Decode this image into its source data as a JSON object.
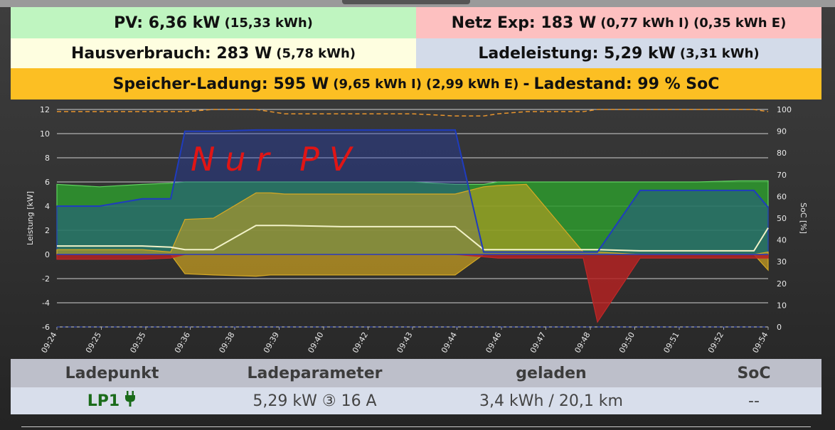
{
  "summary": {
    "pv_main": "PV: 6,36 kW",
    "pv_sub": "(15,33 kWh)",
    "netz_main": "Netz Exp: 183 W",
    "netz_sub1": "(0,77 kWh I)",
    "netz_sub2": "(0,35 kWh E)",
    "haus_main": "Hausverbrauch: 283 W",
    "haus_sub": "(5,78 kWh)",
    "lade_main": "Ladeleistung: 5,29 kW",
    "lade_sub": "(3,31 kWh)",
    "speicher_main": "Speicher-Ladung: 595 W",
    "speicher_sub1": "(9,65 kWh I)",
    "speicher_sub2": "(2,99 kWh E)",
    "speicher_sep": "-",
    "speicher_soc": "Ladestand: 99 % SoC"
  },
  "colors": {
    "pv": "#2e9a2e",
    "netz": "#b32222",
    "haus": "#f2f2c8",
    "ladepunkt": "#1f3cbf",
    "speicher": "#cfa21f",
    "soc": "#e8952e"
  },
  "chart_data": {
    "type": "area",
    "annotation": "Nur PV",
    "ylabel": "Leistung [kW]",
    "y2label": "SoC [%]",
    "ylim": [
      -6,
      12
    ],
    "y2lim": [
      0,
      100
    ],
    "yticks": [
      "12",
      "10",
      "8",
      "6",
      "4",
      "2",
      "0",
      "-2",
      "-4",
      "-6"
    ],
    "y2ticks": [
      "100",
      "90",
      "80",
      "70",
      "60",
      "50",
      "40",
      "30",
      "20",
      "10",
      "0"
    ],
    "xticks": [
      "09:24",
      "09:25",
      "09:35",
      "09:36",
      "09:38",
      "09:39",
      "09:40",
      "09:42",
      "09:43",
      "09:44",
      "09:46",
      "09:47",
      "09:48",
      "09:50",
      "09:51",
      "09:52",
      "09:54"
    ],
    "grid": true,
    "x": [
      0,
      3,
      6,
      8,
      9,
      11,
      14,
      15,
      16,
      20,
      25,
      28,
      30,
      31,
      33,
      37,
      38,
      41,
      44,
      45,
      48,
      49,
      50
    ],
    "series": [
      {
        "values": [
          5.8,
          5.6,
          5.8,
          5.9,
          6.0,
          6.0,
          6.0,
          6.0,
          6.0,
          6.0,
          6.0,
          5.8,
          5.8,
          6.0,
          6.0,
          6.0,
          6.0,
          6.0,
          6.0,
          6.0,
          6.1,
          6.1,
          6.1
        ]
      },
      {
        "values": [
          -0.4,
          -0.4,
          -0.4,
          -0.3,
          0,
          0,
          0,
          0,
          0,
          0,
          0,
          0,
          -0.2,
          -0.3,
          -0.3,
          -0.3,
          -5.6,
          -0.3,
          -0.3,
          -0.3,
          -0.3,
          -0.3,
          -0.3
        ]
      },
      {
        "values": [
          0.7,
          0.7,
          0.7,
          0.6,
          0.4,
          0.4,
          2.4,
          2.4,
          2.4,
          2.3,
          2.3,
          2.3,
          0.4,
          0.4,
          0.4,
          0.4,
          0.4,
          0.3,
          0.3,
          0.3,
          0.3,
          0.3,
          2.2
        ]
      },
      {
        "values": [
          4.0,
          4.0,
          4.6,
          4.6,
          10.2,
          10.2,
          10.3,
          10.3,
          10.3,
          10.3,
          10.3,
          10.3,
          0.2,
          0.2,
          0.2,
          0.2,
          0.2,
          5.3,
          5.3,
          5.3,
          5.3,
          5.3,
          3.9
        ]
      },
      {
        "values": [
          0.4,
          0.4,
          0.4,
          0.2,
          2.9,
          3.0,
          5.1,
          5.1,
          5.0,
          5.0,
          5.0,
          5.0,
          5.6,
          5.7,
          5.8,
          0.2,
          0.2,
          0,
          0,
          0,
          0,
          0,
          0.2
        ]
      },
      {
        "values": [
          0,
          0,
          0,
          0,
          -1.6,
          -1.7,
          -1.8,
          -1.7,
          -1.7,
          -1.7,
          -1.7,
          -1.7,
          0,
          0,
          0,
          0,
          0,
          0,
          0,
          0,
          0,
          0,
          -1.3
        ]
      },
      {
        "values": [
          99,
          99,
          99,
          99,
          99,
          100,
          100,
          99,
          98,
          98,
          98,
          97,
          97,
          98,
          99,
          99,
          100,
          100,
          100,
          100,
          100,
          100,
          99
        ]
      }
    ]
  },
  "table": {
    "headers": [
      "Ladepunkt",
      "Ladeparameter",
      "geladen",
      "SoC"
    ],
    "row": {
      "ladepunkt": "LP1",
      "plug_icon": "🔌",
      "parameter": "5,29 kW ③ 16 A",
      "geladen": "3,4 kWh / 20,1 km",
      "soc": "--"
    }
  }
}
